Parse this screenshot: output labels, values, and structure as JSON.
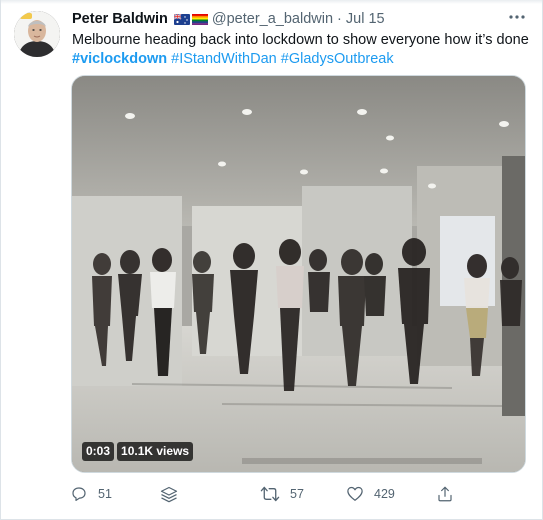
{
  "tweet": {
    "display_name": "Peter Baldwin",
    "flags": [
      "australia-flag-icon",
      "rainbow-flag-icon"
    ],
    "handle": "@peter_a_baldwin",
    "separator": "·",
    "date": "Jul 15",
    "text": "Melbourne heading back into  lockdown to show everyone how it’s done",
    "hashtags": [
      "#viclockdown",
      "#IStandWithDan",
      "#GladysOutbreak"
    ]
  },
  "video": {
    "duration": "0:03",
    "views": "10.1K views"
  },
  "actions": {
    "reply_count": "51",
    "retweet_count": "57",
    "like_count": "429"
  },
  "icons": {
    "more": "more-dots-icon",
    "reply": "reply-icon",
    "stack": "stack-icon",
    "retweet": "retweet-icon",
    "like": "heart-icon",
    "share": "share-icon"
  },
  "colors": {
    "hashtag": "#1d9bf0",
    "secondary_text": "#536471",
    "primary_text": "#0f1419"
  }
}
